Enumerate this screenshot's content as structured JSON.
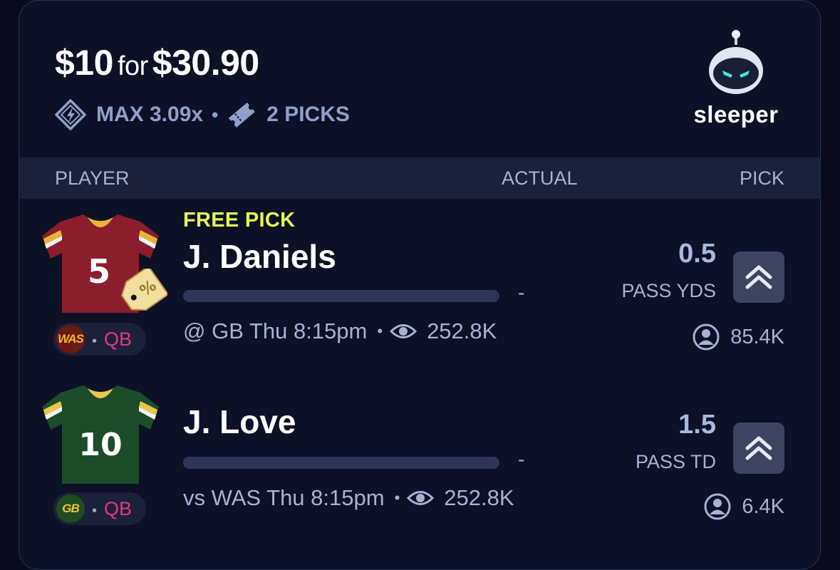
{
  "header": {
    "stake": "$10",
    "connector": "for",
    "payout": "$30.90",
    "max_multiplier": "MAX 3.09x",
    "picks_count": "2 PICKS"
  },
  "brand": {
    "name": "sleeper"
  },
  "columns": {
    "player": "PLAYER",
    "actual": "ACTUAL",
    "pick": "PICK"
  },
  "players": [
    {
      "badge": "FREE PICK",
      "name": "J. Daniels",
      "jersey_number": "5",
      "team": "WAS",
      "position": "QB",
      "actual": "-",
      "game": "@ GB Thu 8:15pm",
      "views": "252.8K",
      "line": "0.5",
      "stat": "PASS YDS",
      "pickers": "85.4K",
      "jersey_color": "#8c1d2c",
      "team_color": "#6b1a16"
    },
    {
      "name": "J. Love",
      "jersey_number": "10",
      "team": "GB",
      "position": "QB",
      "actual": "-",
      "game": "vs WAS Thu 8:15pm",
      "views": "252.8K",
      "line": "1.5",
      "stat": "PASS TD",
      "pickers": "6.4K",
      "jersey_color": "#1c4d2b",
      "team_color": "#1e4c23"
    }
  ],
  "icons": {
    "max": "diamond-bolt-icon",
    "ticket": "ticket-icon",
    "views": "eye-icon",
    "pickers": "user-circle-icon",
    "pick_direction": "double-chevron-up-icon",
    "free_pick_tag": "discount-tag-icon"
  },
  "colors": {
    "background": "#090b1c",
    "card": "#0c1126",
    "free_pick": "#e3f551",
    "position": "#e23a7c",
    "muted": "#a8b3d2"
  }
}
